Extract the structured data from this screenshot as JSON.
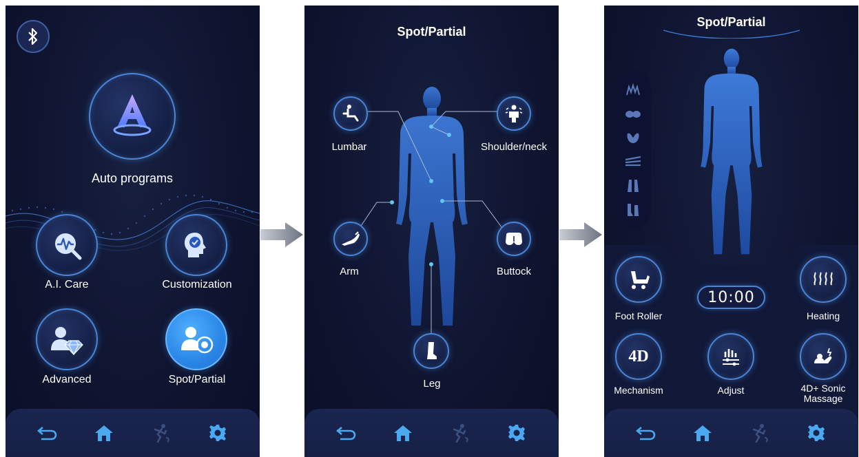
{
  "screens": [
    {
      "id": "home",
      "auto_programs_label": "Auto programs",
      "buttons": [
        {
          "label": "A.I. Care",
          "icon": "ai-care-icon"
        },
        {
          "label": "Customization",
          "icon": "customization-icon"
        },
        {
          "label": "Advanced",
          "icon": "advanced-icon"
        },
        {
          "label": "Spot/Partial",
          "icon": "spot-partial-icon"
        }
      ]
    },
    {
      "id": "spot-partial-select",
      "title": "Spot/Partial",
      "parts": [
        {
          "label": "Lumbar",
          "icon": "lumbar-icon"
        },
        {
          "label": "Shoulder/neck",
          "icon": "shoulder-neck-icon"
        },
        {
          "label": "Arm",
          "icon": "arm-icon"
        },
        {
          "label": "Buttock",
          "icon": "buttock-icon"
        },
        {
          "label": "Leg",
          "icon": "leg-icon"
        }
      ]
    },
    {
      "id": "spot-partial-session",
      "title": "Spot/Partial",
      "timer": "10:00",
      "controls": [
        {
          "label": "Foot Roller",
          "icon": "foot-roller-icon"
        },
        {
          "label": "Heating",
          "icon": "heating-icon"
        },
        {
          "label": "Mechanism",
          "icon_text": "4D"
        },
        {
          "label": "Adjust",
          "icon": "adjust-icon"
        },
        {
          "label": "4D+ Sonic Massage",
          "icon": "sonic-massage-icon"
        }
      ],
      "side_icons": [
        "neck-massage-icon",
        "shoulder-massage-icon",
        "back-massage-icon",
        "waist-massage-icon",
        "leg-massage-icon",
        "foot-massage-icon"
      ]
    }
  ],
  "navbar": {
    "items": [
      "back-icon",
      "home-icon",
      "massage-mode-icon",
      "settings-icon"
    ]
  },
  "colors": {
    "background": "#0f1430",
    "accent": "#4a86d8",
    "active": "#2a86e6",
    "point": "#5fc8f0"
  }
}
